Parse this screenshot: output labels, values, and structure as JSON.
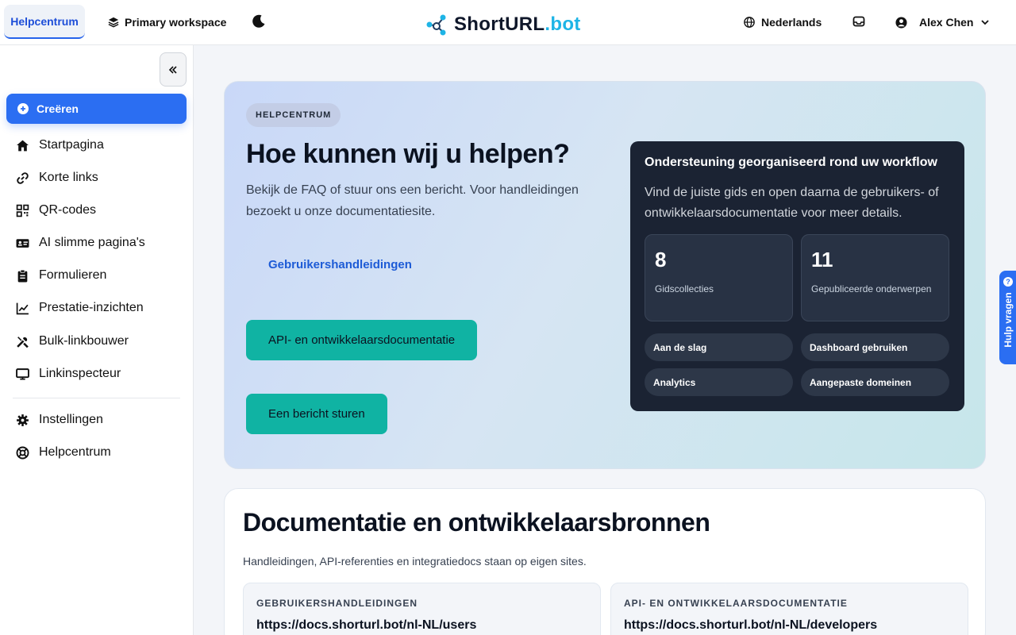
{
  "topbar": {
    "help_tab": "Helpcentrum",
    "workspace": "Primary workspace",
    "brand_part1": "ShortURL",
    "brand_part2": ".bot",
    "language": "Nederlands",
    "user_name": "Alex Chen"
  },
  "sidebar": {
    "create_label": "Creëren",
    "items": [
      {
        "label": "Startpagina",
        "icon": "home-icon"
      },
      {
        "label": "Korte links",
        "icon": "link-icon"
      },
      {
        "label": "QR-codes",
        "icon": "qr-icon"
      },
      {
        "label": "AI slimme pagina's",
        "icon": "id-card-icon"
      },
      {
        "label": "Formulieren",
        "icon": "clipboard-icon"
      },
      {
        "label": "Prestatie-inzichten",
        "icon": "chart-icon"
      },
      {
        "label": "Bulk-linkbouwer",
        "icon": "tools-icon"
      },
      {
        "label": "Linkinspecteur",
        "icon": "monitor-icon"
      }
    ],
    "bottom_items": [
      {
        "label": "Instellingen",
        "icon": "gear-icon"
      },
      {
        "label": "Helpcentrum",
        "icon": "lifebuoy-icon"
      }
    ]
  },
  "hero": {
    "pill": "HELPCENTRUM",
    "title": "Hoe kunnen wij u helpen?",
    "lead": "Bekijk de FAQ of stuur ons een bericht. Voor handleidingen bezoekt u onze documentatiesite.",
    "link_users": "Gebruikershandleidingen",
    "btn_api": "API- en ontwikkelaarsdocumentatie",
    "btn_message": "Een bericht sturen",
    "panel": {
      "title": "Ondersteuning georganiseerd rond uw workflow",
      "desc": "Vind de juiste gids en open daarna de gebruikers- of ontwikkelaarsdocumentatie voor meer details.",
      "stats": [
        {
          "value": "8",
          "label": "Gidscollecties"
        },
        {
          "value": "11",
          "label": "Gepubliceerde onderwerpen"
        }
      ],
      "chips": [
        "Aan de slag",
        "Dashboard gebruiken",
        "Analytics",
        "Aangepaste domeinen"
      ]
    }
  },
  "docs": {
    "title": "Documentatie en ontwikkelaarsbronnen",
    "subtitle": "Handleidingen, API-referenties en integratiedocs staan op eigen sites.",
    "boxes": [
      {
        "caption": "GEBRUIKERSHANDLEIDINGEN",
        "url": "https://docs.shorturl.bot/nl-NL/users"
      },
      {
        "caption": "API- EN ONTWIKKELAARSDOCUMENTATIE",
        "url": "https://docs.shorturl.bot/nl-NL/developers"
      }
    ]
  },
  "help_tab": {
    "label": "Hulp vragen",
    "icon_char": "?"
  },
  "colors": {
    "accent": "#2b6ef2",
    "teal": "#10b3a3",
    "brand_cyan": "#1eb4e6",
    "dark_panel": "#1b2333"
  }
}
